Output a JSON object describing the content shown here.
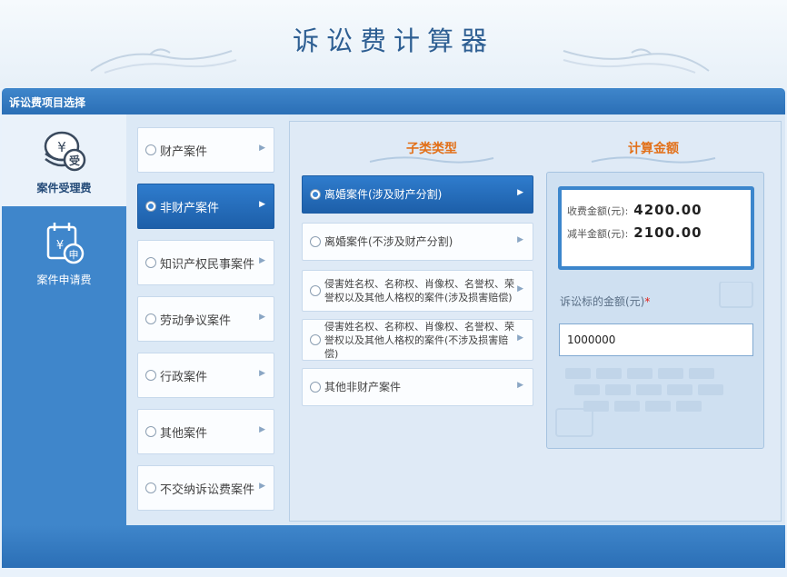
{
  "header": {
    "title": "诉讼费计算器"
  },
  "section": {
    "title": "诉讼费项目选择"
  },
  "nav": [
    {
      "label": "案件受理费",
      "icon": "coin-stack-icon"
    },
    {
      "label": "案件申请费",
      "icon": "calendar-yen-icon"
    }
  ],
  "categories": [
    {
      "label": "财产案件"
    },
    {
      "label": "非财产案件"
    },
    {
      "label": "知识产权民事案件"
    },
    {
      "label": "劳动争议案件"
    },
    {
      "label": "行政案件"
    },
    {
      "label": "其他案件"
    },
    {
      "label": "不交纳诉讼费案件"
    }
  ],
  "panel": {
    "subtype_header": "子类类型",
    "calc_header": "计算金额"
  },
  "subtypes": [
    {
      "label": "离婚案件(涉及财产分割)"
    },
    {
      "label": "离婚案件(不涉及财产分割)"
    },
    {
      "label": "侵害姓名权、名称权、肖像权、名誉权、荣誉权以及其他人格权的案件(涉及损害赔偿)"
    },
    {
      "label": "侵害姓名权、名称权、肖像权、名誉权、荣誉权以及其他人格权的案件(不涉及损害赔偿)"
    },
    {
      "label": "其他非财产案件"
    }
  ],
  "result": {
    "fee_label": "收费金额(元):",
    "fee_value": "4200.00",
    "half_label": "减半金额(元):",
    "half_value": "2100.00"
  },
  "amount": {
    "label": "诉讼标的金额(元)",
    "required_mark": "*",
    "value": "1000000"
  }
}
